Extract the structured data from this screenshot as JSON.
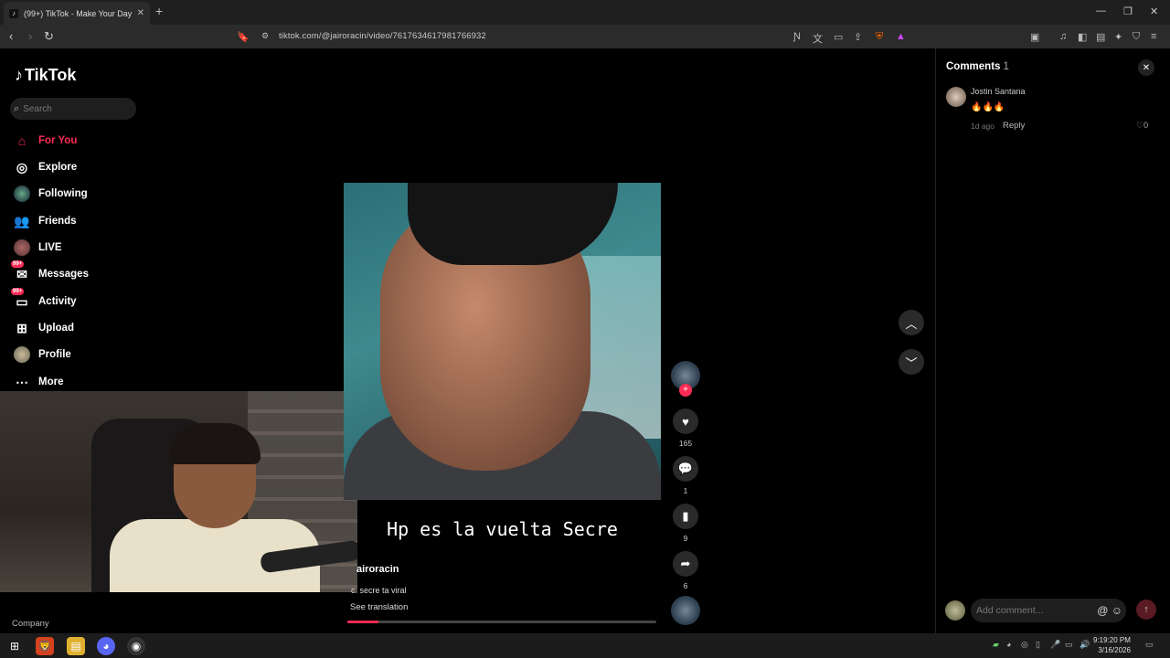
{
  "browser": {
    "tab_title": "(99+) TikTok - Make Your Day",
    "tab_favicon": "tiktok-icon",
    "url": "tiktok.com/@jairoracin/video/7617634617981766932",
    "new_tab_label": "+",
    "minimize": "—",
    "restore": "❐",
    "close": "✕"
  },
  "sidebar": {
    "logo_text": "TikTok",
    "search_placeholder": "Search",
    "items": [
      {
        "label": "For You",
        "icon": "home-icon"
      },
      {
        "label": "Explore",
        "icon": "compass-icon"
      },
      {
        "label": "Following",
        "icon": "following-avatar-icon"
      },
      {
        "label": "Friends",
        "icon": "friends-icon"
      },
      {
        "label": "LIVE",
        "icon": "live-icon"
      },
      {
        "label": "Messages",
        "icon": "messages-icon",
        "badge": "99+"
      },
      {
        "label": "Activity",
        "icon": "activity-icon",
        "badge": "99+"
      },
      {
        "label": "Upload",
        "icon": "upload-icon"
      },
      {
        "label": "Profile",
        "icon": "profile-avatar-icon"
      },
      {
        "label": "More",
        "icon": "more-icon"
      }
    ],
    "company": "Company"
  },
  "video": {
    "caption": "Hp es la vuelta Secre",
    "author": "jairoracin",
    "author_visible": "airoracin",
    "description": "c. secre ta viral",
    "see_translation": "See translation",
    "progress": 0.1
  },
  "actions": {
    "likes": "165",
    "comments": "1",
    "saves": "9",
    "shares": "6",
    "follow": "+"
  },
  "comments": {
    "title": "Comments",
    "count": "1",
    "items": [
      {
        "user": "Jostin Santana",
        "text": "🔥🔥🔥",
        "time": "1d ago",
        "reply": "Reply",
        "likes": "0"
      }
    ],
    "add_placeholder": "Add comment...",
    "mention": "@",
    "emoji": "☺"
  },
  "taskbar": {
    "time": "9:19:20 PM",
    "date": "3/16/2026"
  },
  "colors": {
    "accent": "#fe2c55",
    "background": "#000000"
  }
}
